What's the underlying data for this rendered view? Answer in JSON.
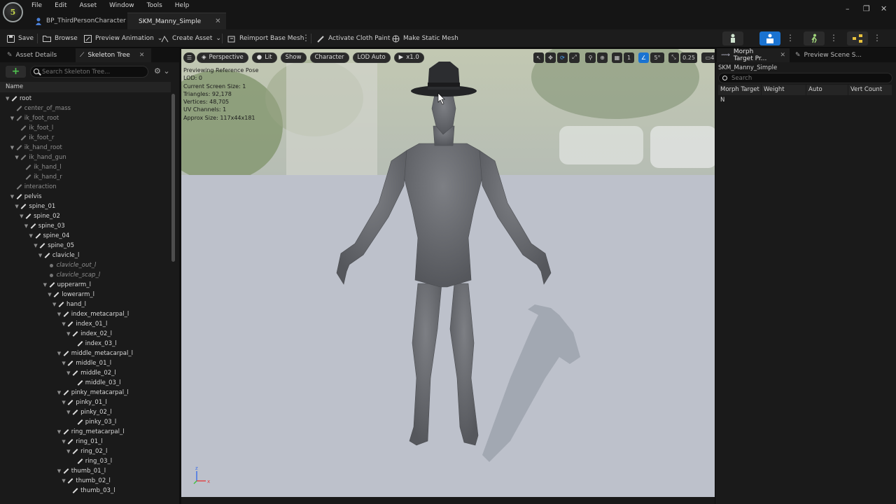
{
  "menu": [
    "File",
    "Edit",
    "Asset",
    "Window",
    "Tools",
    "Help"
  ],
  "app_logo_text": "5",
  "doc_tabs": [
    {
      "label": "BP_ThirdPersonCharacter",
      "icon": "blueprint-person-icon"
    },
    {
      "label": "SKM_Manny_Simple",
      "icon": "skeletal-mesh-icon"
    }
  ],
  "window_controls": {
    "minimize": "–",
    "maximize": "❐",
    "close": "✕"
  },
  "toolbar": {
    "save": "Save",
    "browse": "Browse",
    "preview_animation": "Preview Animation",
    "create_asset": "Create Asset",
    "reimport": "Reimport Base Mesh",
    "activate_cloth": "Activate Cloth Paint",
    "make_static": "Make Static Mesh"
  },
  "left_panel": {
    "tabs": [
      "Asset Details",
      "Skeleton Tree"
    ],
    "search_placeholder": "Search Skeleton Tree...",
    "column_header": "Name",
    "tree": [
      {
        "label": "root",
        "depth": 0,
        "style": "normal",
        "arrow": true
      },
      {
        "label": "center_of_mass",
        "depth": 1,
        "style": "dim",
        "arrow": false
      },
      {
        "label": "ik_foot_root",
        "depth": 1,
        "style": "dim",
        "arrow": true
      },
      {
        "label": "ik_foot_l",
        "depth": 2,
        "style": "dim",
        "arrow": false
      },
      {
        "label": "ik_foot_r",
        "depth": 2,
        "style": "dim",
        "arrow": false
      },
      {
        "label": "ik_hand_root",
        "depth": 1,
        "style": "dim",
        "arrow": true
      },
      {
        "label": "ik_hand_gun",
        "depth": 2,
        "style": "dim",
        "arrow": true
      },
      {
        "label": "ik_hand_l",
        "depth": 3,
        "style": "dim",
        "arrow": false
      },
      {
        "label": "ik_hand_r",
        "depth": 3,
        "style": "dim",
        "arrow": false
      },
      {
        "label": "interaction",
        "depth": 1,
        "style": "dim",
        "arrow": false
      },
      {
        "label": "pelvis",
        "depth": 1,
        "style": "normal",
        "arrow": true
      },
      {
        "label": "spine_01",
        "depth": 2,
        "style": "normal",
        "arrow": true
      },
      {
        "label": "spine_02",
        "depth": 3,
        "style": "normal",
        "arrow": true
      },
      {
        "label": "spine_03",
        "depth": 4,
        "style": "normal",
        "arrow": true
      },
      {
        "label": "spine_04",
        "depth": 5,
        "style": "normal",
        "arrow": true
      },
      {
        "label": "spine_05",
        "depth": 6,
        "style": "normal",
        "arrow": true
      },
      {
        "label": "clavicle_l",
        "depth": 7,
        "style": "normal",
        "arrow": true
      },
      {
        "label": "clavicle_out_l",
        "depth": 8,
        "style": "socket",
        "arrow": false
      },
      {
        "label": "clavicle_scap_l",
        "depth": 8,
        "style": "socket",
        "arrow": false
      },
      {
        "label": "upperarm_l",
        "depth": 8,
        "style": "normal",
        "arrow": true
      },
      {
        "label": "lowerarm_l",
        "depth": 9,
        "style": "normal",
        "arrow": true
      },
      {
        "label": "hand_l",
        "depth": 10,
        "style": "normal",
        "arrow": true
      },
      {
        "label": "index_metacarpal_l",
        "depth": 11,
        "style": "normal",
        "arrow": true
      },
      {
        "label": "index_01_l",
        "depth": 12,
        "style": "normal",
        "arrow": true
      },
      {
        "label": "index_02_l",
        "depth": 13,
        "style": "normal",
        "arrow": true
      },
      {
        "label": "index_03_l",
        "depth": 14,
        "style": "normal",
        "arrow": false
      },
      {
        "label": "middle_metacarpal_l",
        "depth": 11,
        "style": "normal",
        "arrow": true
      },
      {
        "label": "middle_01_l",
        "depth": 12,
        "style": "normal",
        "arrow": true
      },
      {
        "label": "middle_02_l",
        "depth": 13,
        "style": "normal",
        "arrow": true
      },
      {
        "label": "middle_03_l",
        "depth": 14,
        "style": "normal",
        "arrow": false
      },
      {
        "label": "pinky_metacarpal_l",
        "depth": 11,
        "style": "normal",
        "arrow": true
      },
      {
        "label": "pinky_01_l",
        "depth": 12,
        "style": "normal",
        "arrow": true
      },
      {
        "label": "pinky_02_l",
        "depth": 13,
        "style": "normal",
        "arrow": true
      },
      {
        "label": "pinky_03_l",
        "depth": 14,
        "style": "normal",
        "arrow": false
      },
      {
        "label": "ring_metacarpal_l",
        "depth": 11,
        "style": "normal",
        "arrow": true
      },
      {
        "label": "ring_01_l",
        "depth": 12,
        "style": "normal",
        "arrow": true
      },
      {
        "label": "ring_02_l",
        "depth": 13,
        "style": "normal",
        "arrow": true
      },
      {
        "label": "ring_03_l",
        "depth": 14,
        "style": "normal",
        "arrow": false
      },
      {
        "label": "thumb_01_l",
        "depth": 11,
        "style": "normal",
        "arrow": true
      },
      {
        "label": "thumb_02_l",
        "depth": 12,
        "style": "normal",
        "arrow": true
      },
      {
        "label": "thumb_03_l",
        "depth": 13,
        "style": "normal",
        "arrow": false
      }
    ]
  },
  "viewport": {
    "menu_icon": "hamburger-icon",
    "perspective": "Perspective",
    "lit": "Lit",
    "show": "Show",
    "character": "Character",
    "lod": "LOD Auto",
    "play_rate": "x1.0",
    "snap_angle": "5°",
    "camera_speed_scale": "0.25",
    "camera_speed": "4",
    "grid_size": "1",
    "stats": [
      "Previewing Reference Pose",
      "LOD: 0",
      "Current Screen Size: 1",
      "Triangles: 92,178",
      "Vertices: 48,705",
      "UV Channels: 1",
      "Approx Size: 117x44x181"
    ],
    "axis_labels": {
      "z": "z",
      "x": "x"
    }
  },
  "right_panel": {
    "tabs": [
      "Morph Target Pr...",
      "Preview Scene S..."
    ],
    "asset_name": "SKM_Manny_Simple",
    "search_placeholder": "Search",
    "columns": [
      "Morph Target N",
      "Weight",
      "Auto",
      "Vert Count"
    ]
  },
  "colors": {
    "accent": "#1a73d1",
    "add_green": "#4fc24f",
    "panel": "#1a1a1a"
  }
}
